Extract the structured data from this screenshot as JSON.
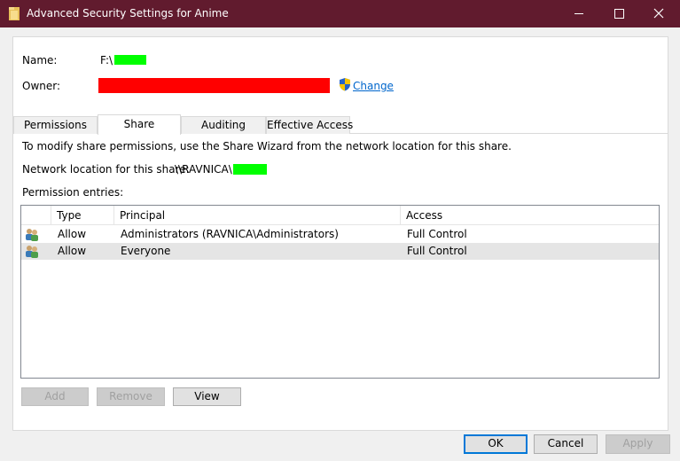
{
  "window": {
    "title": "Advanced Security Settings for Anime"
  },
  "info": {
    "name_label": "Name:",
    "name_value": "F:\\",
    "owner_label": "Owner:",
    "change_label": "Change"
  },
  "tabs": [
    {
      "label": "Permissions"
    },
    {
      "label": "Share"
    },
    {
      "label": "Auditing"
    },
    {
      "label": "Effective Access"
    }
  ],
  "share": {
    "instruction": "To modify share permissions, use the Share Wizard from the network location for this share.",
    "network_label": "Network location for this share:",
    "network_value": "\\\\RAVNICA\\",
    "entries_label": "Permission entries:"
  },
  "table": {
    "headers": [
      "Type",
      "Principal",
      "Access"
    ],
    "rows": [
      {
        "type": "Allow",
        "principal": "Administrators (RAVNICA\\Administrators)",
        "access": "Full Control"
      },
      {
        "type": "Allow",
        "principal": "Everyone",
        "access": "Full Control"
      }
    ]
  },
  "buttons": {
    "add": "Add",
    "remove": "Remove",
    "view": "View",
    "ok": "OK",
    "cancel": "Cancel",
    "apply": "Apply"
  },
  "colors": {
    "titlebar": "#611b2e",
    "link": "#0066cc",
    "redact_green": "#00ff00",
    "redact_red": "#ff0000"
  }
}
